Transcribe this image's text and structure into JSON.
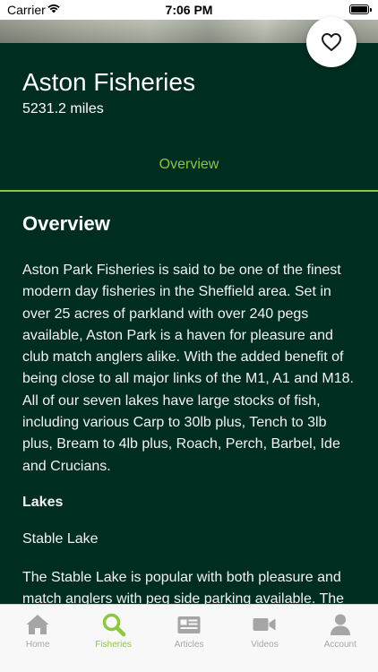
{
  "status_bar": {
    "carrier": "Carrier",
    "time": "7:06 PM"
  },
  "fishery": {
    "name": "Aston Fisheries",
    "distance": "5231.2 miles"
  },
  "tabs": {
    "overview": "Overview"
  },
  "overview": {
    "heading": "Overview",
    "body": "Aston Park Fisheries is said to be one of the finest modern day fisheries in the Sheffield area. Set in over 25 acres of parkland with over 240 pegs available, Aston Park is a haven for pleasure and club match anglers alike. With the added benefit of being close to all major links of the M1, A1 and M18. All of our seven lakes have large stocks of fish, including various Carp to 30lb plus, Tench to 3lb plus, Bream to 4lb plus, Roach, Perch, Barbel, Ide and Crucians.",
    "lakes_heading": "Lakes",
    "lake_name": "Stable Lake",
    "lake_text": "The Stable Lake is popular with both pleasure and match anglers with peg side parking available. The"
  },
  "tab_bar": {
    "items": [
      {
        "label": "Home",
        "icon": "home-icon",
        "active": false
      },
      {
        "label": "Fisheries",
        "icon": "search-icon",
        "active": true
      },
      {
        "label": "Articles",
        "icon": "articles-icon",
        "active": false
      },
      {
        "label": "Videos",
        "icon": "video-icon",
        "active": false
      },
      {
        "label": "Account",
        "icon": "account-icon",
        "active": false
      }
    ]
  },
  "colors": {
    "background": "#002d22",
    "accent": "#8dc63f",
    "tab_inactive": "#a5a5a5"
  }
}
